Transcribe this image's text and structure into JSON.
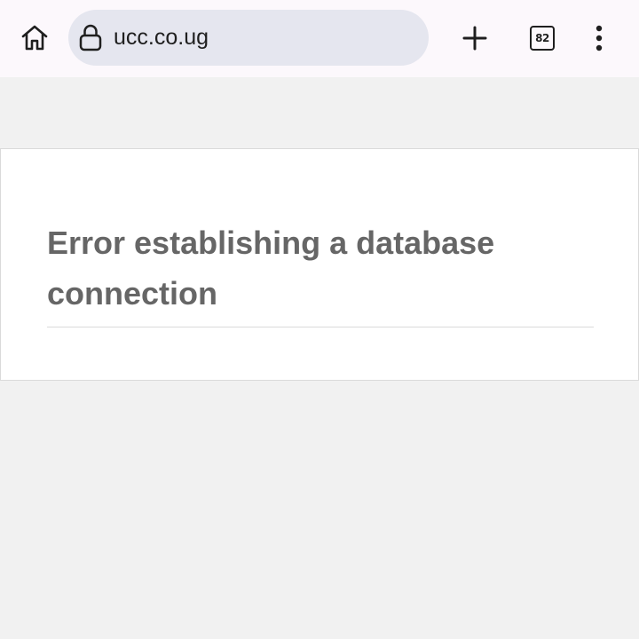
{
  "browser": {
    "url": "ucc.co.ug",
    "tab_count": "82",
    "icons": {
      "home": "home-icon",
      "lock": "lock-icon",
      "new_tab": "plus-icon",
      "tabs": "tab-switcher-icon",
      "menu": "more-vertical-icon"
    }
  },
  "page": {
    "error_message": "Error establishing a database connection"
  },
  "colors": {
    "toolbar_bg": "#fcf8fc",
    "url_bar_bg": "#e5e6ef",
    "page_bg": "#f1f1f1",
    "card_bg": "#ffffff",
    "error_text": "#666666"
  }
}
